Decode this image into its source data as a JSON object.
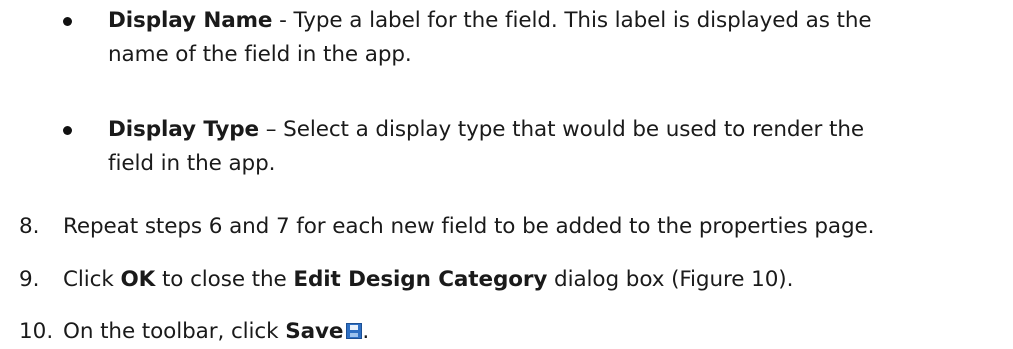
{
  "bullets": [
    {
      "term": "Display Name",
      "line1_rest": " - Type a label for the field. This label is displayed as the",
      "line2": "name of the field in the app."
    },
    {
      "term": "Display Type",
      "line1_rest": " – Select a display type that would be used to render the",
      "line2": "field in the app."
    }
  ],
  "steps": [
    {
      "number": "8.",
      "text": "Repeat steps 6 and 7 for each new field to be added to the properties page."
    },
    {
      "number": "9.",
      "pre": "Click ",
      "bold1": "OK",
      "mid": " to close the ",
      "bold2": "Edit Design Category",
      "post": " dialog box (Figure 10)."
    },
    {
      "number": "10.",
      "pre": "On the toolbar, click ",
      "bold1": "Save",
      "post": ".",
      "icon": "save-icon"
    }
  ]
}
